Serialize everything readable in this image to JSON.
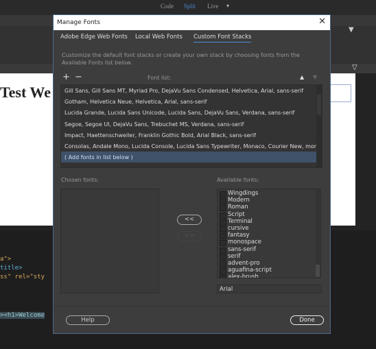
{
  "app": {
    "modes": [
      "Code",
      "Split",
      "Live"
    ],
    "design_heading": "Test We",
    "code_lines": [
      "a\">",
      "title>",
      "ss\" rel=\"sty",
      "><h1>Welcome"
    ]
  },
  "dialog": {
    "title": "Manage Fonts",
    "tabs": [
      {
        "label": "Adobe Edge Web Fonts"
      },
      {
        "label": "Local Web Fonts"
      },
      {
        "label": "Custom Font Stacks",
        "active": true
      }
    ],
    "description": "Customize the default font stacks or create your own stack by choosing fonts from the Available Fonts list below.",
    "font_list_label": "Font list:",
    "font_list": [
      "Gill Sans, Gill Sans MT, Myriad Pro, DejaVu Sans Condensed, Helvetica, Arial, sans-serif",
      "Gotham, Helvetica Neue, Helvetica, Arial, sans-serif",
      "Lucida Grande, Lucida Sans Unicode, Lucida Sans, DejaVu Sans, Verdana, sans-serif",
      "Segoe, Segoe UI, DejaVu Sans, Trebuchet MS, Verdana, sans-serif",
      "Impact, Haettenschweiler, Franklin Gothic Bold, Arial Black, sans-serif",
      "Consolas, Andale Mono, Lucida Console, Lucida Sans Typewriter, Monaco, Courier New, monos...",
      "( Add fonts in list below )"
    ],
    "chosen_label": "Chosen fonts:",
    "available_label": "Available fonts:",
    "available_fonts": [
      "Wingdings",
      "Modern",
      "Roman",
      "Script",
      "Terminal",
      "cursive",
      "fantasy",
      "monospace",
      "sans-serif",
      "serif",
      "advent-pro",
      "aguafina-script",
      "alex-brush"
    ],
    "font_input_value": "Arial",
    "add_label": "<<",
    "remove_label": ">>",
    "help_label": "Help",
    "done_label": "Done"
  }
}
